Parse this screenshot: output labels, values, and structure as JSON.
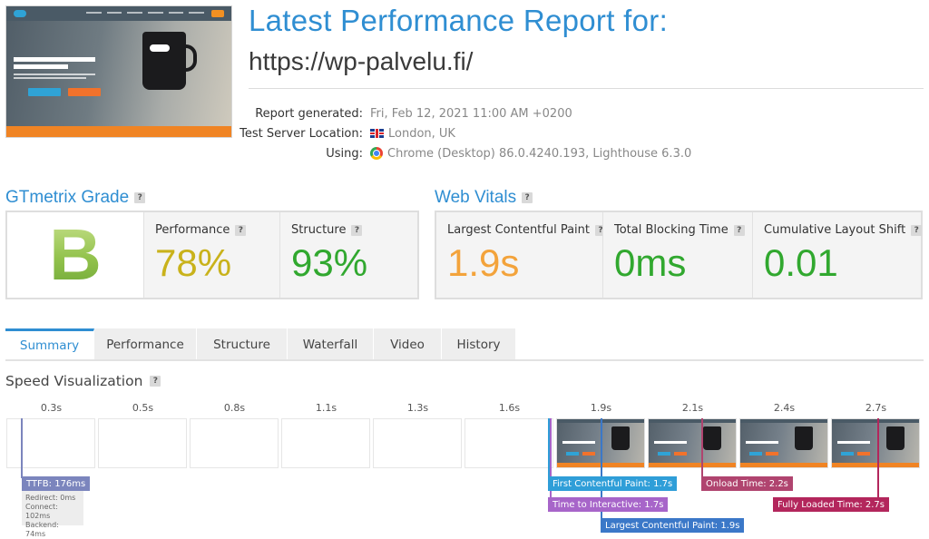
{
  "report": {
    "title": "Latest Performance Report for:",
    "url": "https://wp-palvelu.fi/",
    "meta": [
      {
        "label": "Report generated:",
        "value": "Fri, Feb 12, 2021 11:00 AM +0200"
      },
      {
        "label": "Test Server Location:",
        "value": "London, UK",
        "icon": "uk-flag-icon"
      },
      {
        "label": "Using:",
        "value": "Chrome (Desktop) 86.0.4240.193, Lighthouse 6.3.0",
        "icon": "chrome-icon"
      }
    ]
  },
  "gtmetrix": {
    "title": "GTmetrix Grade",
    "help": "?",
    "grade": "B",
    "performance": {
      "label": "Performance",
      "value": "78%",
      "color": "#c9b21b"
    },
    "structure": {
      "label": "Structure",
      "value": "93%",
      "color": "#31a82f"
    }
  },
  "web_vitals": {
    "title": "Web Vitals",
    "lcp": {
      "label": "Largest Contentful Paint",
      "value": "1.9s",
      "color": "#f3a33b"
    },
    "tbt": {
      "label": "Total Blocking Time",
      "value": "0ms",
      "color": "#31a82f"
    },
    "cls": {
      "label": "Cumulative Layout Shift",
      "value": "0.01",
      "color": "#31a82f"
    }
  },
  "tabs": [
    "Summary",
    "Performance",
    "Structure",
    "Waterfall",
    "Video",
    "History"
  ],
  "speed": {
    "title": "Speed Visualization",
    "ticks": [
      "0.3s",
      "0.5s",
      "0.8s",
      "1.1s",
      "1.3s",
      "1.6s",
      "1.9s",
      "2.1s",
      "2.4s",
      "2.7s"
    ],
    "markers": {
      "ttfb": {
        "label": "TTFB: 176ms",
        "color": "#7b85bd"
      },
      "fcp": {
        "label": "First Contentful Paint: 1.7s",
        "color": "#2f9ed8"
      },
      "tti": {
        "label": "Time to Interactive: 1.7s",
        "color": "#a765c9"
      },
      "lcp": {
        "label": "Largest Contentful Paint: 1.9s",
        "color": "#3b78c8"
      },
      "onload": {
        "label": "Onload Time: 2.2s",
        "color": "#b0446f"
      },
      "fully": {
        "label": "Fully Loaded Time: 2.7s",
        "color": "#b3265c"
      }
    },
    "ttfb_breakdown": {
      "redirect": "Redirect: 0ms",
      "connect": "Connect: 102ms",
      "backend": "Backend: 74ms"
    }
  }
}
